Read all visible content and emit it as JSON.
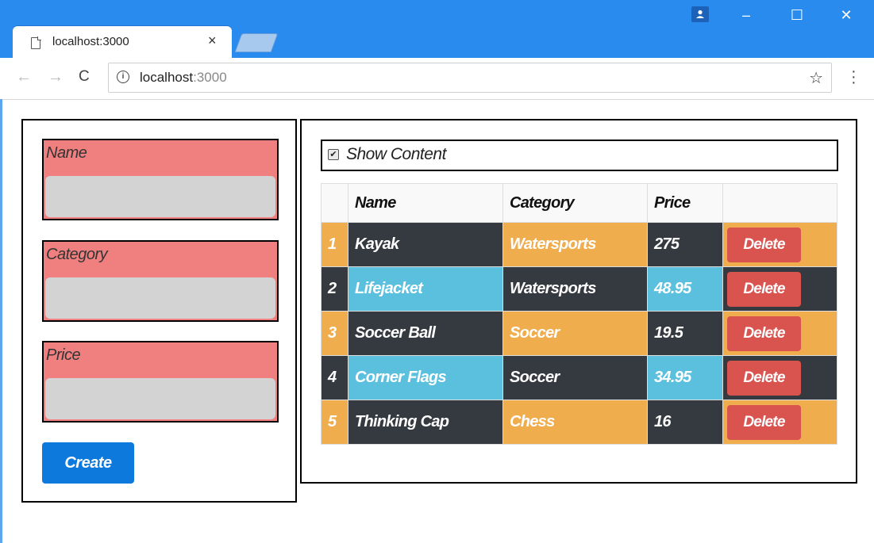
{
  "browser": {
    "tab_title": "localhost:3000",
    "tab_close": "×",
    "url_host": "localhost",
    "url_port": ":3000",
    "window_controls": {
      "minimize": "–",
      "maximize": "☐",
      "close": "✕"
    }
  },
  "form": {
    "fields": [
      {
        "label": "Name",
        "value": ""
      },
      {
        "label": "Category",
        "value": ""
      },
      {
        "label": "Price",
        "value": ""
      }
    ],
    "create_label": "Create"
  },
  "toggle": {
    "label": "Show Content",
    "checked": true
  },
  "table": {
    "headers": [
      "",
      "Name",
      "Category",
      "Price",
      ""
    ],
    "rows": [
      {
        "index": "1",
        "name": "Kayak",
        "category": "Watersports",
        "price": "275",
        "action": "Delete"
      },
      {
        "index": "2",
        "name": "Lifejacket",
        "category": "Watersports",
        "price": "48.95",
        "action": "Delete"
      },
      {
        "index": "3",
        "name": "Soccer Ball",
        "category": "Soccer",
        "price": "19.5",
        "action": "Delete"
      },
      {
        "index": "4",
        "name": "Corner Flags",
        "category": "Soccer",
        "price": "34.95",
        "action": "Delete"
      },
      {
        "index": "5",
        "name": "Thinking Cap",
        "category": "Chess",
        "price": "16",
        "action": "Delete"
      }
    ]
  },
  "colors": {
    "chrome_blue": "#2a8bef",
    "field_label_bg": "#f08080",
    "input_bg": "#d3d3d3",
    "create_button": "#0e79dc",
    "row_warning": "#f0ad4e",
    "row_dark": "#343a40",
    "row_info": "#5bc0de",
    "delete_button": "#d9534f"
  }
}
